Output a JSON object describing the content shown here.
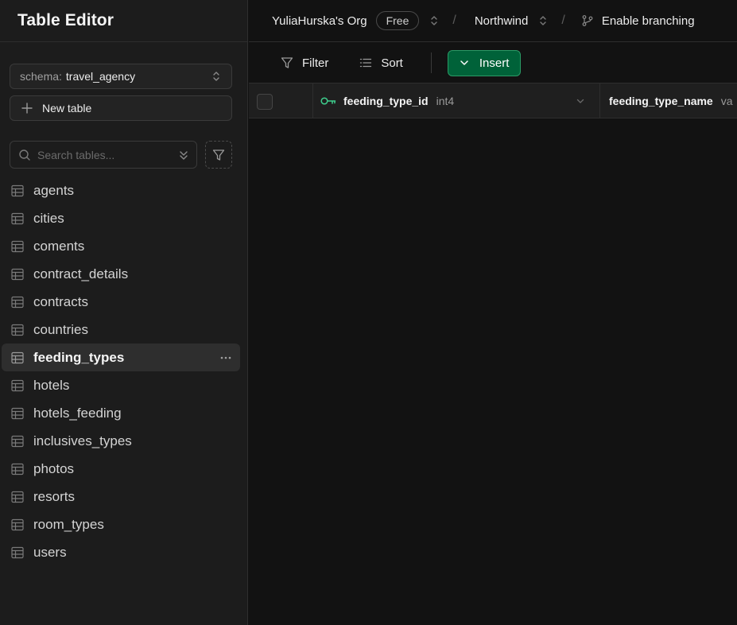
{
  "sidebar": {
    "title": "Table Editor",
    "schema": {
      "prefix": "schema:",
      "value": "travel_agency"
    },
    "new_table_label": "New table",
    "search": {
      "placeholder": "Search tables..."
    },
    "tables": [
      {
        "label": "agents"
      },
      {
        "label": "cities"
      },
      {
        "label": "coments"
      },
      {
        "label": "contract_details"
      },
      {
        "label": "contracts"
      },
      {
        "label": "countries"
      },
      {
        "label": "feeding_types",
        "active": true
      },
      {
        "label": "hotels"
      },
      {
        "label": "hotels_feeding"
      },
      {
        "label": "inclusives_types"
      },
      {
        "label": "photos"
      },
      {
        "label": "resorts"
      },
      {
        "label": "room_types"
      },
      {
        "label": "users"
      }
    ]
  },
  "topbar": {
    "org": "YuliaHurska's Org",
    "plan_badge": "Free",
    "project": "Northwind",
    "branching_label": "Enable branching"
  },
  "toolbar": {
    "filter_label": "Filter",
    "sort_label": "Sort",
    "insert_label": "Insert"
  },
  "grid": {
    "columns": [
      {
        "name": "feeding_type_id",
        "type": "int4",
        "primary_key": true
      },
      {
        "name": "feeding_type_name",
        "type": "va"
      }
    ]
  },
  "colors": {
    "background": "#121212",
    "sidebar": "#1c1c1c",
    "accent_green": "#006239",
    "key_icon": "#3ecf8e"
  }
}
